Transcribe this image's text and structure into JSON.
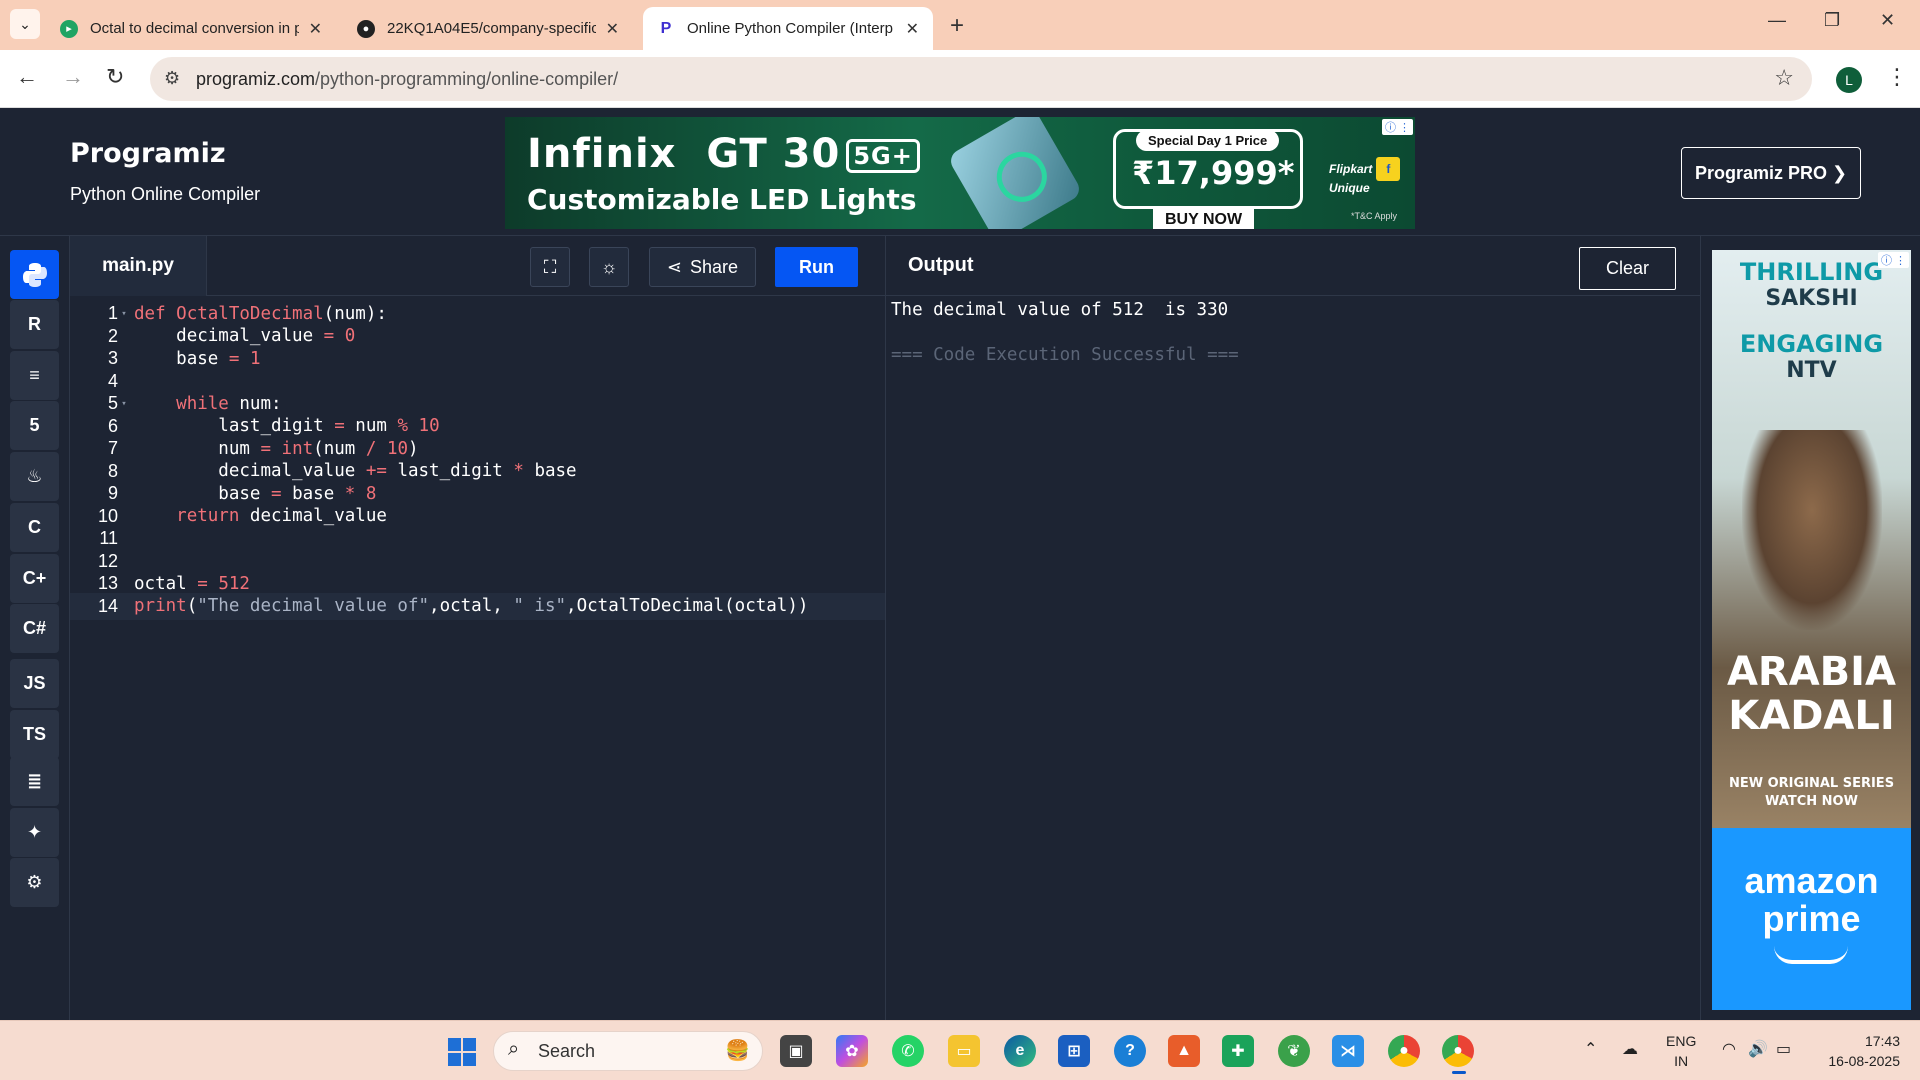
{
  "browser": {
    "tabs": [
      {
        "title": "Octal to decimal conversion in p",
        "favicon": "green-shield"
      },
      {
        "title": "22KQ1A04E5/company-specific",
        "favicon": "github"
      },
      {
        "title": "Online Python Compiler (Interp",
        "favicon": "programiz"
      }
    ],
    "url_host": "programiz.com",
    "url_path": "/python-programming/online-compiler/",
    "profile_initial": "L"
  },
  "header": {
    "logo": "Programiz",
    "subtitle": "Python Online Compiler",
    "pro_button": "Programiz PRO ❯"
  },
  "ad_banner": {
    "brand": "Infinix",
    "model": "GT 30",
    "badge": "5G+",
    "tagline": "Customizable LED Lights",
    "special": "Special Day 1 Price",
    "price": "₹17,999*",
    "cta": "BUY NOW",
    "partner": "Flipkart",
    "partner_sub": "Unique",
    "terms": "*T&C Apply"
  },
  "languages": [
    "python",
    "r",
    "sql",
    "html",
    "java",
    "c",
    "cpp",
    "csharp",
    "JS",
    "TS",
    "go",
    "swift",
    "rust"
  ],
  "editor": {
    "filename": "main.py",
    "share_label": "Share",
    "run_label": "Run",
    "lines": [
      "def OctalToDecimal(num):",
      "    decimal_value = 0",
      "    base = 1",
      "",
      "    while num:",
      "        last_digit = num % 10",
      "        num = int(num / 10)",
      "        decimal_value += last_digit * base",
      "        base = base * 8",
      "    return decimal_value",
      "",
      "",
      "octal = 512",
      "print(\"The decimal value of\",octal, \" is\",OctalToDecimal(octal))"
    ]
  },
  "output": {
    "title": "Output",
    "clear_label": "Clear",
    "lines": [
      {
        "text": "The decimal value of 512  is 330",
        "color": "#ffffff"
      },
      {
        "text": "",
        "color": "#ffffff"
      },
      {
        "text": "=== Code Execution Successful ===",
        "color": "#5b6577"
      }
    ]
  },
  "right_ad": {
    "line1": "THRILLING",
    "line2": "SAKSHI",
    "line3": "ENGAGING",
    "line4": "NTV",
    "title1": "ARABIA",
    "title2": "KADALI",
    "tag1": "NEW ORIGINAL SERIES",
    "tag2": "WATCH NOW",
    "prime1": "amazon",
    "prime2": "prime"
  },
  "taskbar": {
    "search": "Search",
    "lang1": "ENG",
    "lang2": "IN",
    "time": "17:43",
    "date": "16-08-2025"
  }
}
